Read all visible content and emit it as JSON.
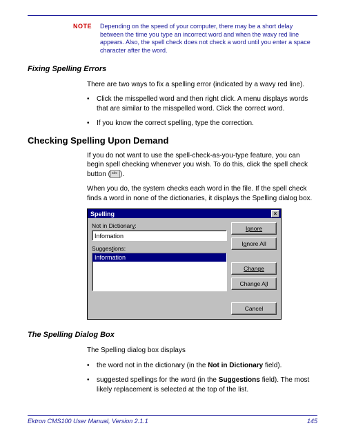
{
  "note": {
    "label": "NOTE",
    "text": "Depending on the speed of your computer, there may be a short delay between the time you type an incorrect word and when the wavy red line appears. Also, the spell check does not check a word until you enter a space character after the word."
  },
  "s1": {
    "heading": "Fixing Spelling Errors",
    "para": "There are two ways to fix a spelling error (indicated by a wavy red line).",
    "bullets": [
      "Click the misspelled word and then right click. A menu displays words that are similar to the misspelled word. Click the correct word.",
      "If you know the correct spelling, type the correction."
    ]
  },
  "s2": {
    "heading": "Checking Spelling Upon Demand",
    "para1_a": "If you do not want to use the spell-check-as-you-type feature, you can begin spell checking whenever you wish. To do this, click the spell check button (",
    "para1_b": ").",
    "para2": "When you do, the system checks each word in the file. If the spell check finds a word in none of the dictionaries, it displays the Spelling dialog box."
  },
  "dialog": {
    "title": "Spelling",
    "close": "×",
    "not_in_dict_label_a": "Not in Dictionar",
    "not_in_dict_label_b": "y",
    "not_in_dict_label_c": ":",
    "not_in_dict_value": "Infomation",
    "suggestions_label_a": "Sugges",
    "suggestions_label_b": "t",
    "suggestions_label_c": "ions:",
    "suggestions_selected": "Information",
    "buttons": {
      "ignore": "Ignore",
      "ignore_all_a": "I",
      "ignore_all_b": "g",
      "ignore_all_c": "nore All",
      "change": "Change",
      "change_all_a": "Change A",
      "change_all_b": "l",
      "change_all_c": "l",
      "cancel": "Cancel"
    }
  },
  "s3": {
    "heading": "The Spelling Dialog Box",
    "para": "The Spelling dialog box displays",
    "bullets_b1_a": "the word not in the dictionary (in the ",
    "bullets_b1_b": "Not in Dictionary",
    "bullets_b1_c": " field).",
    "bullets_b2_a": "suggested spellings for the word (in the ",
    "bullets_b2_b": "Suggestions",
    "bullets_b2_c": " field). The most likely replacement is selected at the top of the list."
  },
  "footer": {
    "left": "Ektron CMS100 User Manual, Version 2.1.1",
    "right": "145"
  }
}
